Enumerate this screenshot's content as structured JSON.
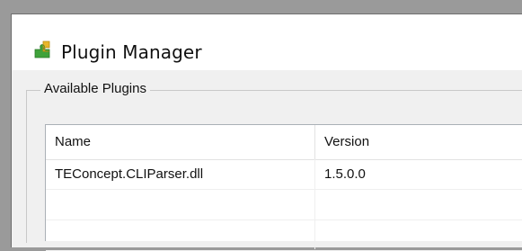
{
  "window": {
    "title": "Plugin Manager",
    "icon": "puzzle-piece-icon"
  },
  "group": {
    "legend": "Available Plugins"
  },
  "list": {
    "columns": [
      "Name",
      "Version"
    ],
    "rows": [
      {
        "name": "TEConcept.CLIParser.dll",
        "version": "1.5.0.0"
      },
      {
        "name": "",
        "version": ""
      },
      {
        "name": "",
        "version": ""
      }
    ]
  },
  "colors": {
    "background": "#9a9a9a",
    "window": "#f0f0f0",
    "titlebar": "#ffffff",
    "icon_green": "#3fa23a",
    "icon_yellow": "#e8b62a"
  }
}
